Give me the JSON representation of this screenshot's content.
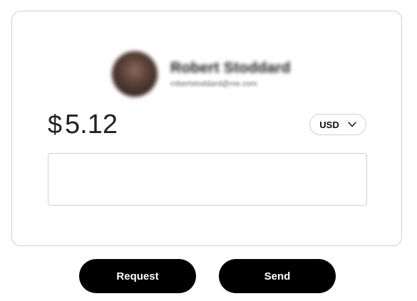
{
  "recipient": {
    "name": "Robert Stoddard",
    "email": "robertstoddard@me.com"
  },
  "amount": {
    "symbol": "$",
    "value": "5.12"
  },
  "currency": {
    "selected": "USD",
    "icon": "chevron-down-icon"
  },
  "note": {
    "value": "",
    "placeholder": ""
  },
  "actions": {
    "request_label": "Request",
    "send_label": "Send"
  },
  "colors": {
    "button_bg": "#000000",
    "button_text": "#ffffff",
    "border": "#cfcfcf"
  }
}
